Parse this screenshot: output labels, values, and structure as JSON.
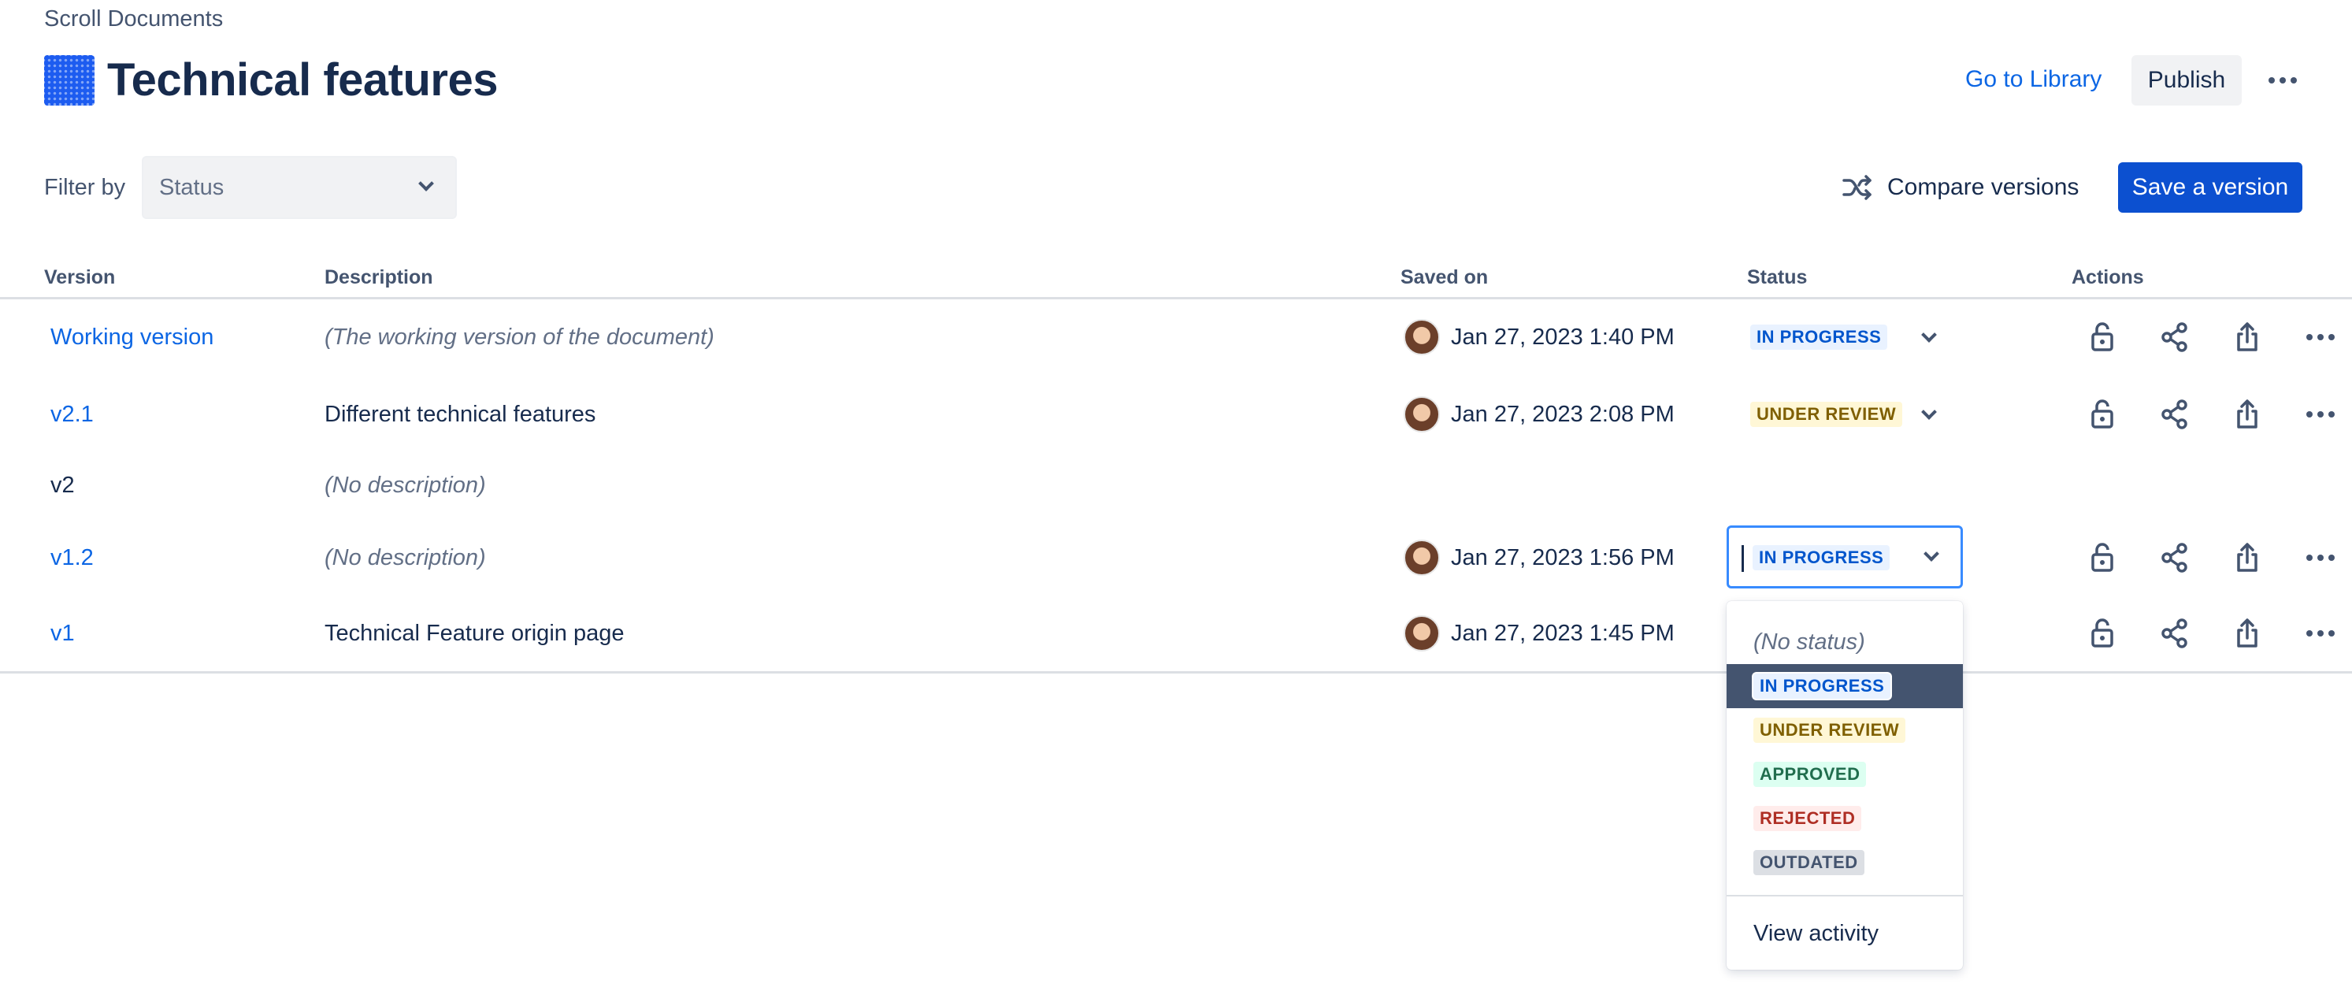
{
  "header": {
    "app_name": "Scroll Documents",
    "title": "Technical features",
    "go_to_library": "Go to Library",
    "publish": "Publish"
  },
  "filter": {
    "label": "Filter by",
    "select_value": "Status"
  },
  "toolbar": {
    "compare": "Compare versions",
    "save": "Save a version"
  },
  "table": {
    "columns": [
      "Version",
      "Description",
      "Saved on",
      "Status",
      "Actions"
    ],
    "rows": [
      {
        "version": "Working version",
        "description": "(The working version of the document)",
        "saved_on": "Jan 27, 2023 1:40 PM",
        "status": "IN PROGRESS"
      },
      {
        "version": "v2.1",
        "description": "Different technical features",
        "saved_on": "Jan 27, 2023 2:08 PM",
        "status": "UNDER REVIEW"
      },
      {
        "version": "v2",
        "description": "(No description)",
        "saved_on": "",
        "status": ""
      },
      {
        "version": "v1.2",
        "description": "(No description)",
        "saved_on": "Jan 27, 2023 1:56 PM",
        "status": "IN PROGRESS"
      },
      {
        "version": "v1",
        "description": "Technical Feature origin page",
        "saved_on": "Jan 27, 2023 1:45 PM",
        "status": ""
      }
    ]
  },
  "status_menu": {
    "no_status": "(No status)",
    "options": [
      "IN PROGRESS",
      "UNDER REVIEW",
      "APPROVED",
      "REJECTED",
      "OUTDATED"
    ],
    "selected": "IN PROGRESS",
    "view_activity": "View activity"
  },
  "colors": {
    "link": "#0c66e4",
    "primary_button": "#0c50d0",
    "in_progress_bg": "#e9f2ff",
    "under_review_bg": "#fff7d6",
    "approved_bg": "#dcfff1",
    "rejected_bg": "#ffeceb",
    "outdated_bg": "#dcdfe4",
    "menu_selected_bg": "#44546f"
  },
  "icons": [
    "scroll-documents-icon",
    "chevron-down-icon",
    "compare-shuffle-icon",
    "lock-icon",
    "share-icon",
    "export-icon",
    "more-horizontal-icon",
    "avatar"
  ]
}
